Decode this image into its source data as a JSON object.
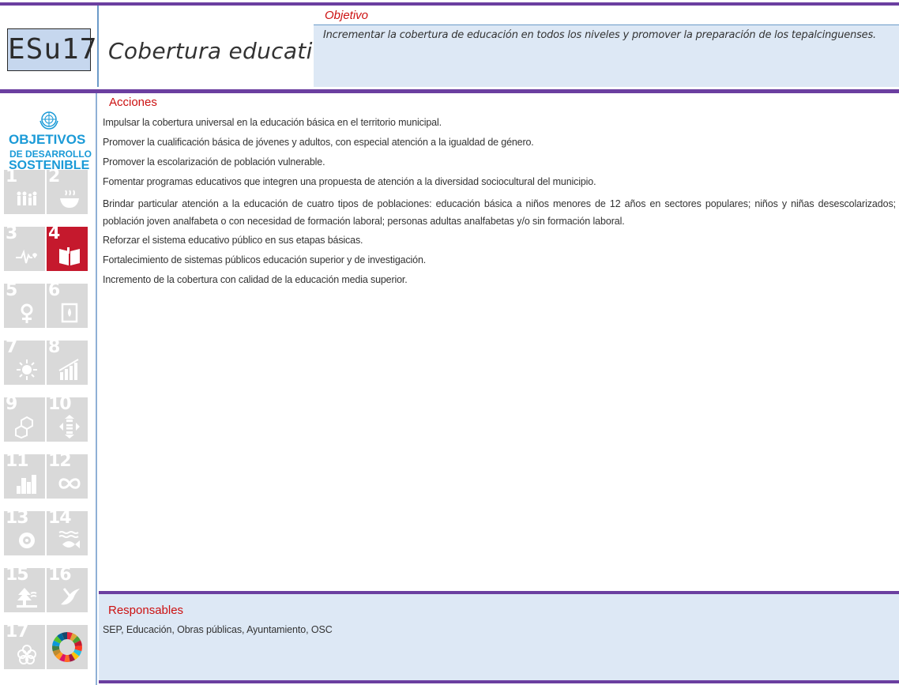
{
  "header": {
    "code": "ESu17",
    "theme_title": "Cobertura educativa",
    "objective_label": "Objetivo",
    "objective_text": "Incrementar la cobertura de educación en todos los niveles y promover la preparación de los tepalcinguenses."
  },
  "sidebar": {
    "title_line1": "OBJETIVOS",
    "title_line2": "DE DESARROLLO",
    "title_line3": "SOSTENIBLE",
    "active_goal": "4",
    "goals": [
      {
        "num": "1",
        "icon": "people-icon"
      },
      {
        "num": "2",
        "icon": "bowl-icon"
      },
      {
        "num": "3",
        "icon": "heartbeat-icon"
      },
      {
        "num": "4",
        "icon": "book-icon"
      },
      {
        "num": "5",
        "icon": "gender-icon"
      },
      {
        "num": "6",
        "icon": "water-icon"
      },
      {
        "num": "7",
        "icon": "sun-icon"
      },
      {
        "num": "8",
        "icon": "growth-chart-icon"
      },
      {
        "num": "9",
        "icon": "cubes-icon"
      },
      {
        "num": "10",
        "icon": "equality-icon"
      },
      {
        "num": "11",
        "icon": "city-icon"
      },
      {
        "num": "12",
        "icon": "infinity-icon"
      },
      {
        "num": "13",
        "icon": "eye-globe-icon"
      },
      {
        "num": "14",
        "icon": "fish-icon"
      },
      {
        "num": "15",
        "icon": "tree-icon"
      },
      {
        "num": "16",
        "icon": "dove-icon"
      },
      {
        "num": "17",
        "icon": "flower-icon"
      },
      {
        "num": "",
        "icon": "sdg-wheel-icon"
      }
    ],
    "colors": {
      "title": "#1a9ad7",
      "active": "#c5192d",
      "inactive": "#d9d9d9"
    }
  },
  "actions": {
    "title": "Acciones",
    "items": [
      "Impulsar la cobertura universal en la educación básica en el territorio municipal.",
      "Promover la cualificación básica de jóvenes y adultos, con especial atención a la igualdad de género.",
      "Promover la escolarización de población vulnerable.",
      "Fomentar programas educativos que integren una propuesta de atención a la diversidad sociocultural del municipio.",
      "Brindar particular atención a la educación de cuatro tipos de poblaciones: educación básica a niños menores de 12 años en sectores populares; niños y niñas desescolarizados; población joven analfabeta o con necesidad de formación laboral; personas adultas analfabetas y/o sin formación laboral.",
      "Reforzar el sistema educativo público en sus etapas básicas.",
      "Fortalecimiento de sistemas públicos educación superior y de investigación.",
      "Incremento de la cobertura con calidad de la educación media superior."
    ]
  },
  "responsables": {
    "title": "Responsables",
    "text": "SEP, Educación, Obras públicas, Ayuntamiento, OSC"
  },
  "colors": {
    "accent_purple": "#6b3fa0",
    "label_red": "#cc1111",
    "panel_blue": "#dde8f5",
    "code_box": "#c6d7ee"
  }
}
